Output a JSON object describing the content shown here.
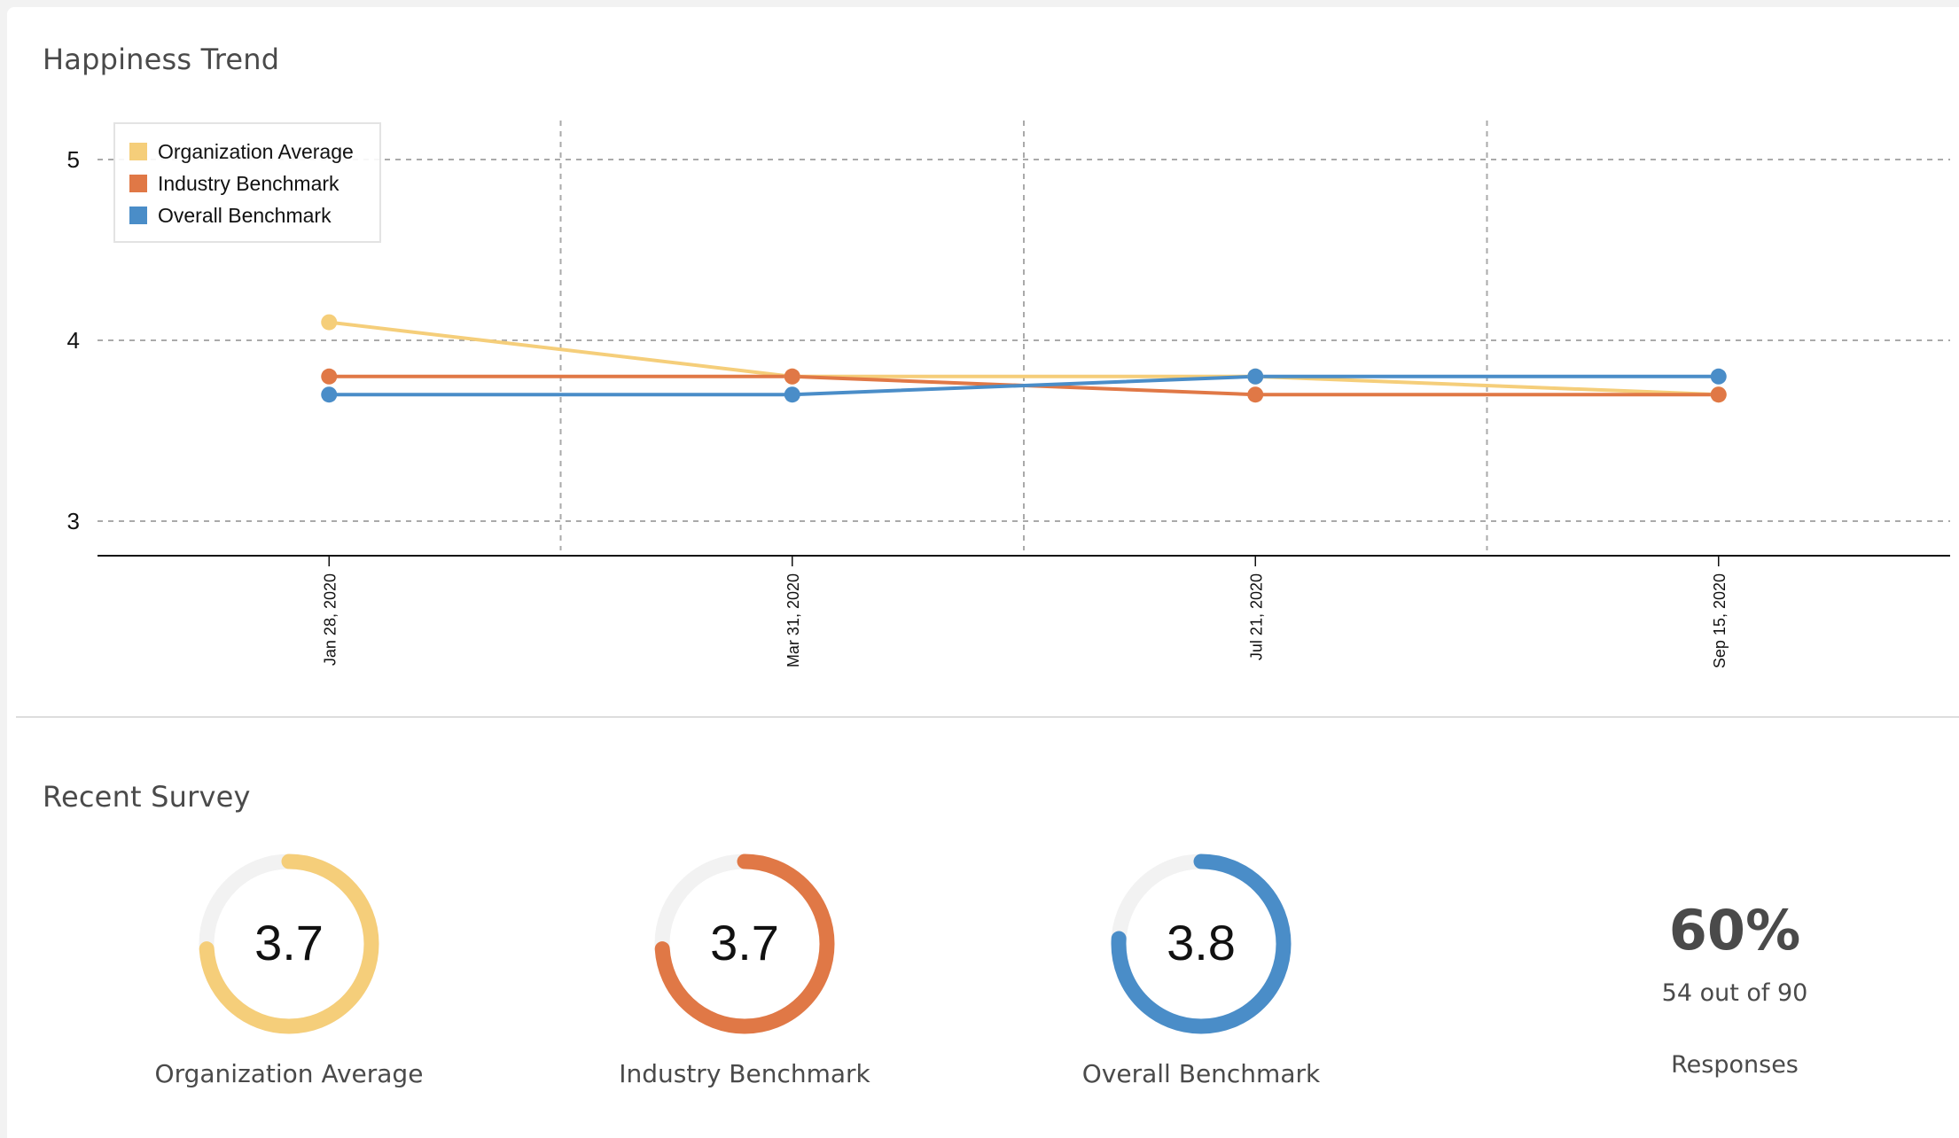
{
  "trend": {
    "title": "Happiness Trend"
  },
  "survey": {
    "title": "Recent Survey",
    "gauges": [
      {
        "label": "Organization Average",
        "value": "3.7",
        "score": 3.7,
        "max": 5,
        "color": "#f5ce7a"
      },
      {
        "label": "Industry Benchmark",
        "value": "3.7",
        "score": 3.7,
        "max": 5,
        "color": "#e07846"
      },
      {
        "label": "Overall Benchmark",
        "value": "3.8",
        "score": 3.8,
        "max": 5,
        "color": "#4a8dc8"
      }
    ],
    "responses": {
      "percent": "60%",
      "detail": "54 out of 90",
      "label": "Responses"
    }
  },
  "colors": {
    "track": "#f2f2f2",
    "grid": "#aaaaaa",
    "axis": "#111111"
  },
  "chart_data": {
    "type": "line",
    "title": "Happiness Trend",
    "xlabel": "",
    "ylabel": "",
    "x": [
      "Jan 28, 2020",
      "Mar 31, 2020",
      "Jul 21, 2020",
      "Sep 15, 2020"
    ],
    "ylim": [
      2.8,
      5.2
    ],
    "yticks": [
      3,
      4,
      5
    ],
    "grid": true,
    "legend_position": "top-left",
    "series": [
      {
        "name": "Organization Average",
        "color": "#f5ce7a",
        "values": [
          4.1,
          3.8,
          3.8,
          3.7
        ]
      },
      {
        "name": "Industry Benchmark",
        "color": "#e07846",
        "values": [
          3.8,
          3.8,
          3.7,
          3.7
        ]
      },
      {
        "name": "Overall Benchmark",
        "color": "#4a8dc8",
        "values": [
          3.7,
          3.7,
          3.8,
          3.8
        ]
      }
    ]
  }
}
